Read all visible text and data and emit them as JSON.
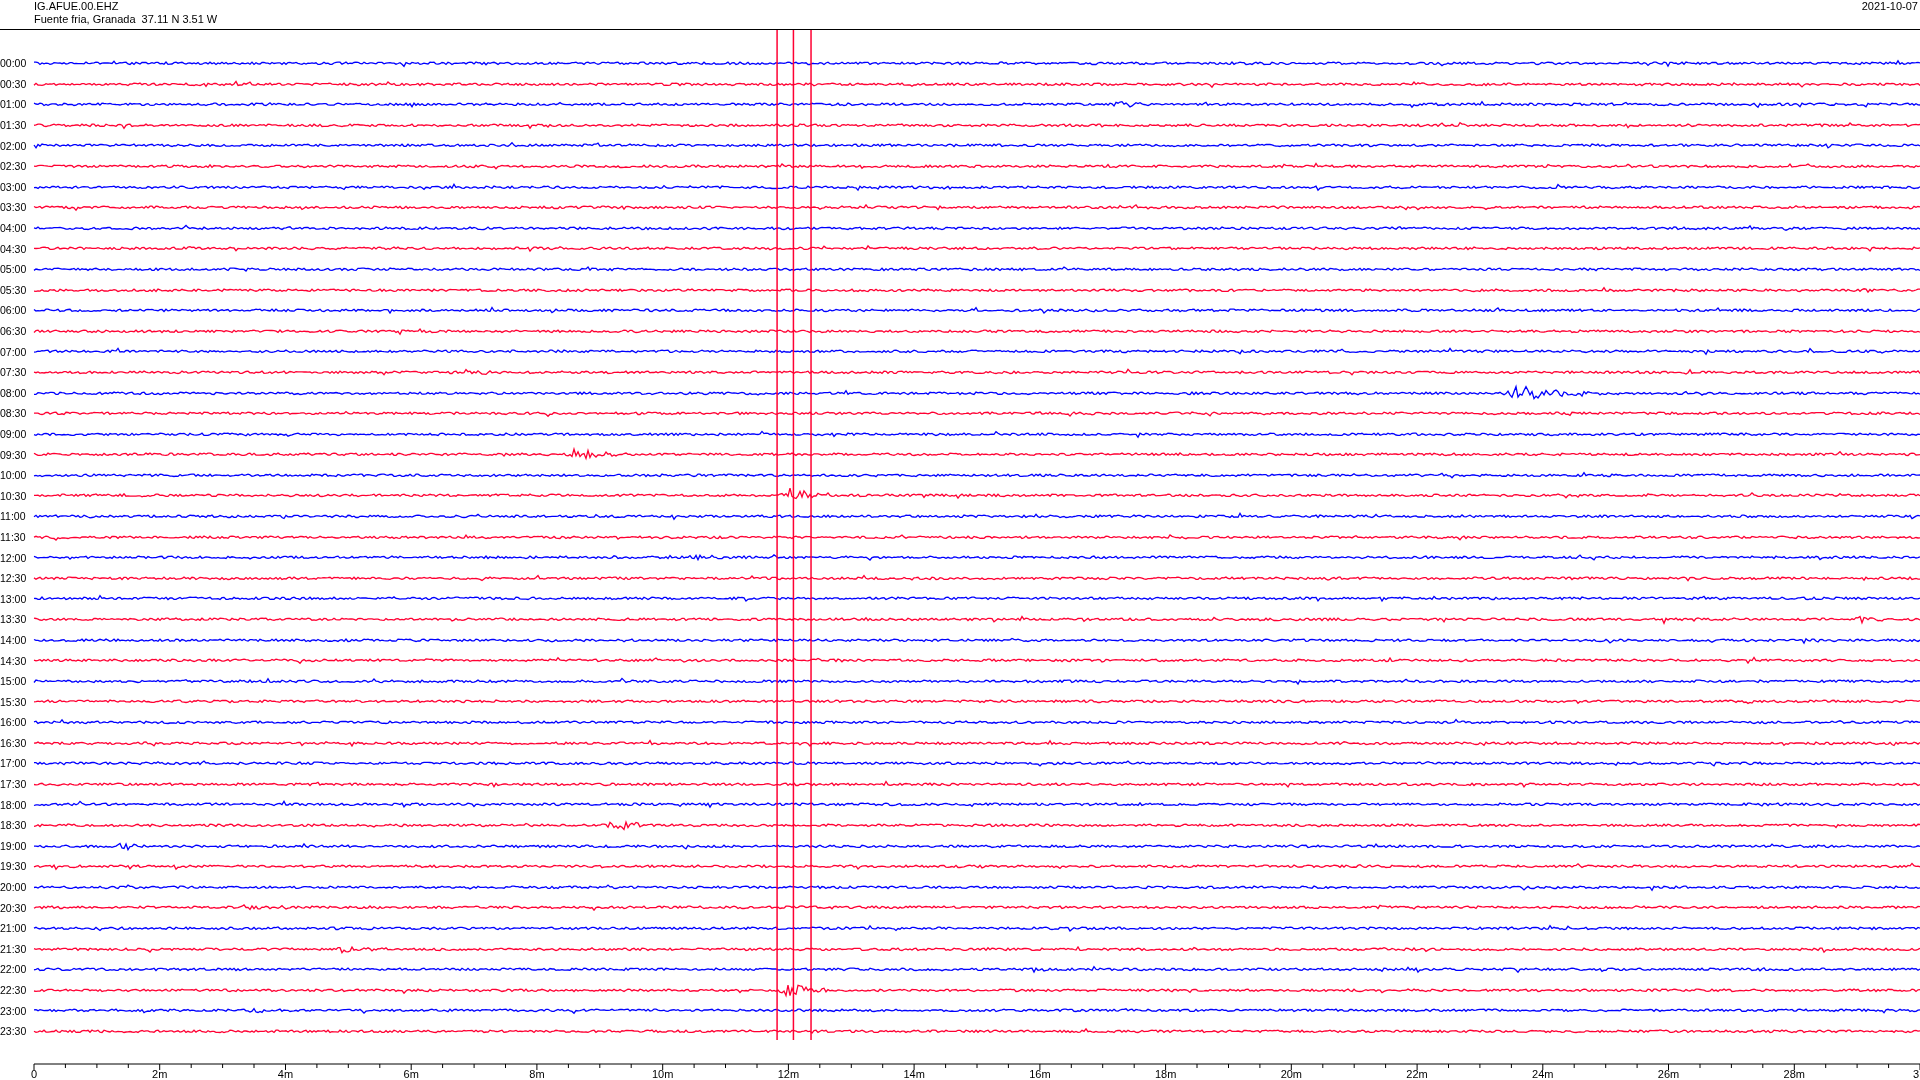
{
  "header": {
    "station": "IG.AFUE.00.EHZ",
    "location": "Fuente fria, Granada  37.11 N 3.51 W",
    "date": "2021-10-07"
  },
  "traces": [
    {
      "time": "00:00",
      "color": "#0000ff"
    },
    {
      "time": "00:30",
      "color": "#ff0033"
    },
    {
      "time": "01:00",
      "color": "#0000ff"
    },
    {
      "time": "01:30",
      "color": "#ff0033"
    },
    {
      "time": "02:00",
      "color": "#0000ff"
    },
    {
      "time": "02:30",
      "color": "#ff0033"
    },
    {
      "time": "03:00",
      "color": "#0000ff"
    },
    {
      "time": "03:30",
      "color": "#ff0033"
    },
    {
      "time": "04:00",
      "color": "#0000ff"
    },
    {
      "time": "04:30",
      "color": "#ff0033"
    },
    {
      "time": "05:00",
      "color": "#0000ff"
    },
    {
      "time": "05:30",
      "color": "#ff0033"
    },
    {
      "time": "06:00",
      "color": "#0000ff"
    },
    {
      "time": "06:30",
      "color": "#ff0033"
    },
    {
      "time": "07:00",
      "color": "#0000ff"
    },
    {
      "time": "07:30",
      "color": "#ff0033"
    },
    {
      "time": "08:00",
      "color": "#0000ff"
    },
    {
      "time": "08:30",
      "color": "#ff0033"
    },
    {
      "time": "09:00",
      "color": "#0000ff"
    },
    {
      "time": "09:30",
      "color": "#ff0033"
    },
    {
      "time": "10:00",
      "color": "#0000ff"
    },
    {
      "time": "10:30",
      "color": "#ff0033"
    },
    {
      "time": "11:00",
      "color": "#0000ff"
    },
    {
      "time": "11:30",
      "color": "#ff0033"
    },
    {
      "time": "12:00",
      "color": "#0000ff"
    },
    {
      "time": "12:30",
      "color": "#ff0033"
    },
    {
      "time": "13:00",
      "color": "#0000ff"
    },
    {
      "time": "13:30",
      "color": "#ff0033"
    },
    {
      "time": "14:00",
      "color": "#0000ff"
    },
    {
      "time": "14:30",
      "color": "#ff0033"
    },
    {
      "time": "15:00",
      "color": "#0000ff"
    },
    {
      "time": "15:30",
      "color": "#ff0033"
    },
    {
      "time": "16:00",
      "color": "#0000ff"
    },
    {
      "time": "16:30",
      "color": "#ff0033"
    },
    {
      "time": "17:00",
      "color": "#0000ff"
    },
    {
      "time": "17:30",
      "color": "#ff0033"
    },
    {
      "time": "18:00",
      "color": "#0000ff"
    },
    {
      "time": "18:30",
      "color": "#ff0033"
    },
    {
      "time": "19:00",
      "color": "#0000ff"
    },
    {
      "time": "19:30",
      "color": "#ff0033"
    },
    {
      "time": "20:00",
      "color": "#0000ff"
    },
    {
      "time": "20:30",
      "color": "#ff0033"
    },
    {
      "time": "21:00",
      "color": "#0000ff"
    },
    {
      "time": "21:30",
      "color": "#ff0033"
    },
    {
      "time": "22:00",
      "color": "#0000ff"
    },
    {
      "time": "22:30",
      "color": "#ff0033"
    },
    {
      "time": "23:00",
      "color": "#0000ff"
    },
    {
      "time": "23:30",
      "color": "#ff0033"
    }
  ],
  "x_axis": {
    "labels": [
      "0",
      "2m",
      "4m",
      "6m",
      "8m",
      "10m",
      "12m",
      "14m",
      "16m",
      "18m",
      "20m",
      "22m",
      "24m",
      "26m",
      "28m",
      "3"
    ]
  }
}
